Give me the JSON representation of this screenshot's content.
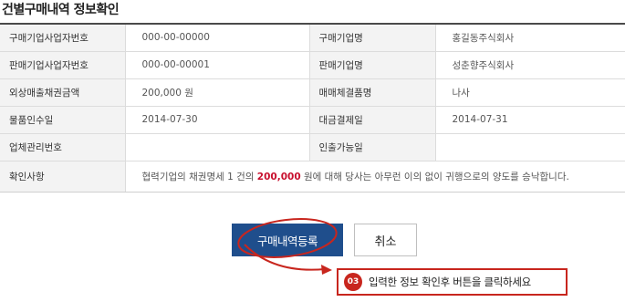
{
  "page": {
    "title": "건별구매내역 정보확인"
  },
  "table": {
    "rows": [
      {
        "label1": "구매기업사업자번호",
        "value1": "000-00-00000",
        "label2": "구매기업명",
        "value2": "홍길동주식회사"
      },
      {
        "label1": "판매기업사업자번호",
        "value1": "000-00-00001",
        "label2": "판매기업명",
        "value2": "성춘향주식회사"
      },
      {
        "label1": "외상매출채권금액",
        "value1": "200,000 원",
        "label2": "매매체결품명",
        "value2": "나사"
      },
      {
        "label1": "물품인수일",
        "value1": "2014-07-30",
        "label2": "대금결제일",
        "value2": "2014-07-31"
      },
      {
        "label1": "업체관리번호",
        "value1": "",
        "label2": "인출가능일",
        "value2": ""
      }
    ],
    "confirm": {
      "label": "확인사항",
      "text_before": "협력기업의 채권명세 1 건의 ",
      "amount": "200,000",
      "text_after": " 원에 대해 당사는 아무런 이의 없이 귀행으로의 양도를 승낙합니다."
    }
  },
  "buttons": {
    "register": "구매내역등록",
    "cancel": "취소"
  },
  "callout": {
    "step": "03",
    "text": "입력한 정보 확인후 버튼을 클릭하세요"
  },
  "colors": {
    "primary": "#1f4e8c",
    "accent_red": "#c8261e",
    "amount_red": "#c8102e",
    "header_bg": "#f3f3f3"
  }
}
